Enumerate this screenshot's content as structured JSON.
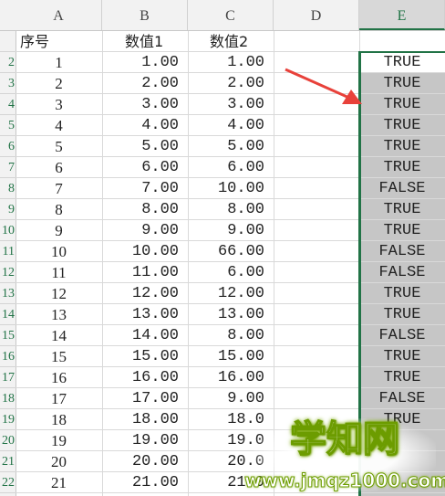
{
  "columns": [
    "A",
    "B",
    "C",
    "D",
    "E"
  ],
  "headers": {
    "a": "序号",
    "b": "数值1",
    "c": "数值2"
  },
  "rows": [
    {
      "num": "2",
      "a": "1",
      "b": "1.00",
      "c": "1.00",
      "e": "TRUE"
    },
    {
      "num": "3",
      "a": "2",
      "b": "2.00",
      "c": "2.00",
      "e": "TRUE"
    },
    {
      "num": "4",
      "a": "3",
      "b": "3.00",
      "c": "3.00",
      "e": "TRUE"
    },
    {
      "num": "5",
      "a": "4",
      "b": "4.00",
      "c": "4.00",
      "e": "TRUE"
    },
    {
      "num": "6",
      "a": "5",
      "b": "5.00",
      "c": "5.00",
      "e": "TRUE"
    },
    {
      "num": "7",
      "a": "6",
      "b": "6.00",
      "c": "6.00",
      "e": "TRUE"
    },
    {
      "num": "8",
      "a": "7",
      "b": "7.00",
      "c": "10.00",
      "e": "FALSE"
    },
    {
      "num": "9",
      "a": "8",
      "b": "8.00",
      "c": "8.00",
      "e": "TRUE"
    },
    {
      "num": "10",
      "a": "9",
      "b": "9.00",
      "c": "9.00",
      "e": "TRUE"
    },
    {
      "num": "11",
      "a": "10",
      "b": "10.00",
      "c": "66.00",
      "e": "FALSE"
    },
    {
      "num": "12",
      "a": "11",
      "b": "11.00",
      "c": "6.00",
      "e": "FALSE"
    },
    {
      "num": "13",
      "a": "12",
      "b": "12.00",
      "c": "12.00",
      "e": "TRUE"
    },
    {
      "num": "14",
      "a": "13",
      "b": "13.00",
      "c": "13.00",
      "e": "TRUE"
    },
    {
      "num": "15",
      "a": "14",
      "b": "14.00",
      "c": "8.00",
      "e": "FALSE"
    },
    {
      "num": "16",
      "a": "15",
      "b": "15.00",
      "c": "15.00",
      "e": "TRUE"
    },
    {
      "num": "17",
      "a": "16",
      "b": "16.00",
      "c": "16.00",
      "e": "TRUE"
    },
    {
      "num": "18",
      "a": "17",
      "b": "17.00",
      "c": "9.00",
      "e": "FALSE"
    },
    {
      "num": "19",
      "a": "18",
      "b": "18.00",
      "c": "18.0",
      "e": "TRUE"
    },
    {
      "num": "20",
      "a": "19",
      "b": "19.00",
      "c": "19.0",
      "e": ""
    },
    {
      "num": "21",
      "a": "20",
      "b": "20.00",
      "c": "20.0",
      "e": ""
    },
    {
      "num": "22",
      "a": "21",
      "b": "21.00",
      "c": "21.0",
      "e": ""
    }
  ],
  "watermark": {
    "main": "学知网",
    "url": "www.jmqz1000.com"
  },
  "colors": {
    "selection": "#217346",
    "arrow": "#e8413a",
    "selected_fill": "#c6c6c6"
  }
}
